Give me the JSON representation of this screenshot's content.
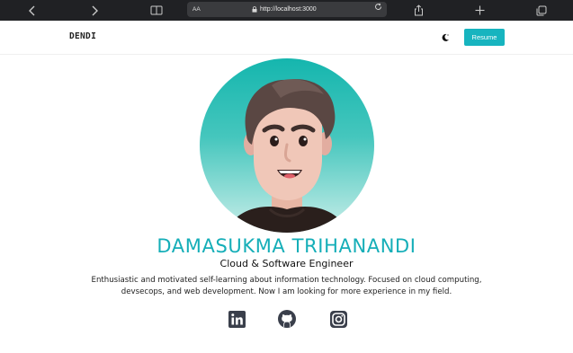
{
  "browser": {
    "aa_label": "AA",
    "url": "http://localhost:3000",
    "icons": [
      "chevron-left-icon",
      "chevron-right-icon",
      "book-icon",
      "lock-icon",
      "reload-icon",
      "share-icon",
      "plus-icon",
      "tabs-icon"
    ]
  },
  "nav": {
    "brand": "DENDI",
    "theme_icon": "moon-icon",
    "resume_label": "Resume",
    "accent_color": "#17b4bf"
  },
  "hero": {
    "name": "DAMASUKMA TRIHANANDI",
    "role": "Cloud & Software Engineer",
    "bio_line1": "Enthusiastic and motivated self-learning about information technology. Focused on cloud computing,",
    "bio_line2": "devsecops, and web development. Now I am looking for more experience in my field.",
    "name_color": "#15aeb8"
  },
  "socials": [
    {
      "icon": "linkedin-icon"
    },
    {
      "icon": "github-icon"
    },
    {
      "icon": "instagram-icon"
    }
  ]
}
